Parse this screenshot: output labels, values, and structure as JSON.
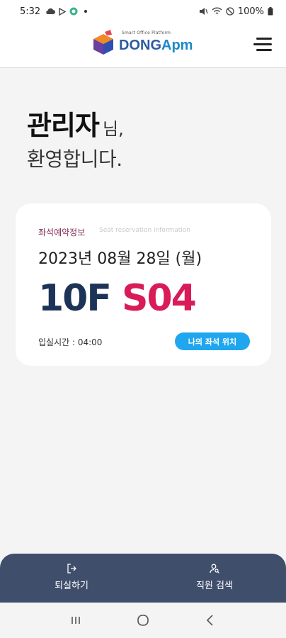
{
  "status_bar": {
    "time": "5:32",
    "battery": "100%"
  },
  "header": {
    "logo_tagline": "Smart Office Platform",
    "logo_name_part1": "DONG",
    "logo_name_part2": "Apm"
  },
  "greeting": {
    "name": "관리자",
    "honorific": "님,",
    "welcome": "환영합니다."
  },
  "reservation_card": {
    "title": "좌석예약정보",
    "subtitle": "Seat reservation information",
    "date": "2023년 08월 28일 (월)",
    "floor": "10F",
    "seat": "S04",
    "entry_time": "입실시간 : 04:00",
    "locate_button_label": "나의 좌석 위치"
  },
  "bottom_nav": {
    "checkout_label": "퇴실하기",
    "employee_search_label": "직원 검색"
  },
  "colors": {
    "floor": "#1d3357",
    "seat": "#d91b58",
    "accent_button": "#1fa6ee",
    "bottom_nav_bg": "#3f4e6b"
  }
}
